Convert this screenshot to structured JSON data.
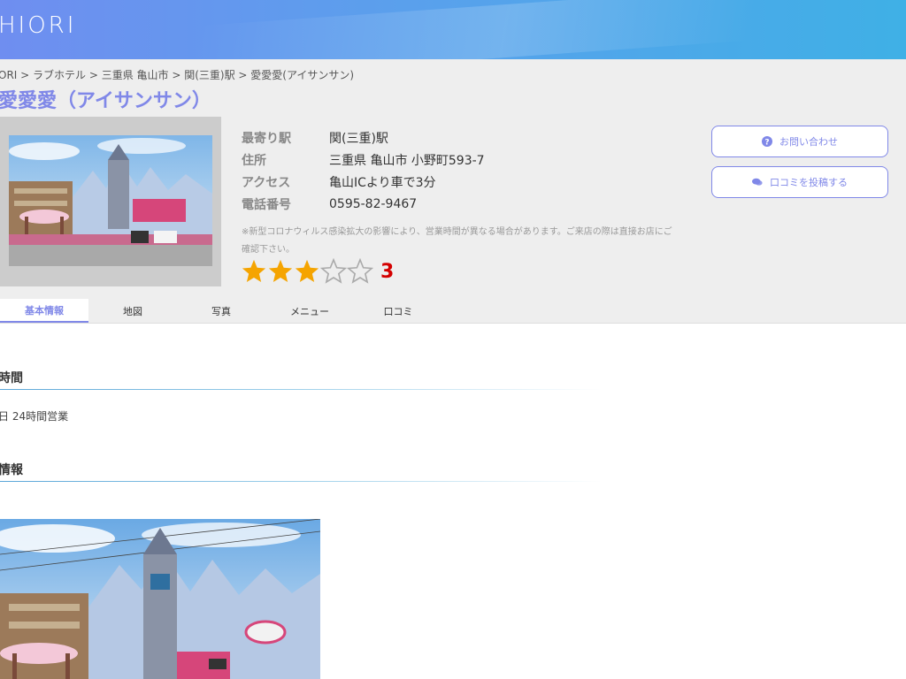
{
  "header": {
    "logo": "HIORI"
  },
  "breadcrumb": {
    "items": [
      "ORI",
      "ラブホテル",
      "三重県 亀山市",
      "関(三重)駅",
      "愛愛愛(アイサンサン)"
    ],
    "separator": " > "
  },
  "hotel": {
    "title": "愛愛愛（アイサンサン）",
    "info": [
      {
        "label": "最寄り駅",
        "value": "関(三重)駅"
      },
      {
        "label": "住所",
        "value": "三重県 亀山市 小野町593-7"
      },
      {
        "label": "アクセス",
        "value": "亀山ICより車で3分"
      },
      {
        "label": "電話番号",
        "value": "0595-82-9467"
      }
    ],
    "notice": "※新型コロナウィルス感染拡大の影響により、営業時間が異なる場合があります。ご来店の際は直接お店にご確認下さい。",
    "rating": {
      "value": 3,
      "max": 5,
      "label": "3"
    }
  },
  "buttons": {
    "contact": "お問い合わせ",
    "review": "口コミを投稿する"
  },
  "tabs": [
    {
      "label": "基本情報",
      "active": true
    },
    {
      "label": "地図",
      "active": false
    },
    {
      "label": "写真",
      "active": false
    },
    {
      "label": "メニュー",
      "active": false
    },
    {
      "label": "口コミ",
      "active": false
    }
  ],
  "sections": {
    "hours_title": "時間",
    "hours_text": "日 24時間営業",
    "facility_title": "情報"
  },
  "colors": {
    "accent": "#8088e8",
    "star_filled": "#f5a400",
    "star_empty": "#aaaaaa",
    "rating_text": "#d40000"
  }
}
